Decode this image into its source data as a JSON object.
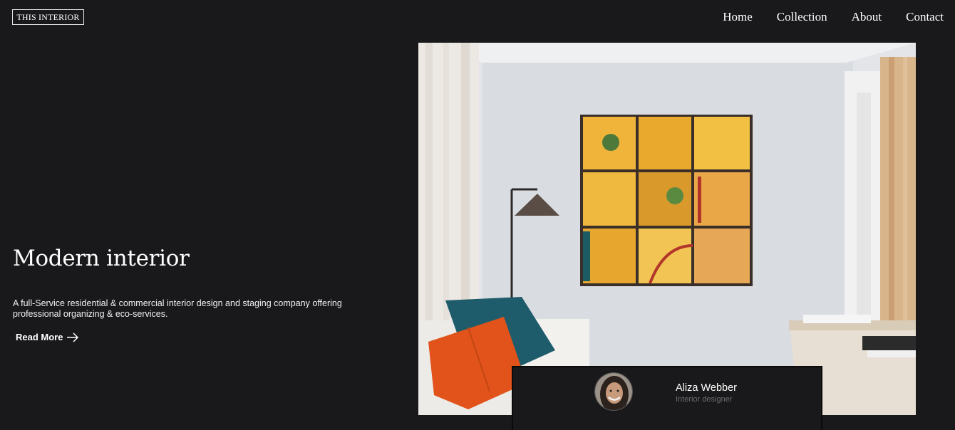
{
  "header": {
    "logo_text": "THIS INTERIOR",
    "nav": [
      {
        "label": "Home"
      },
      {
        "label": "Collection"
      },
      {
        "label": "About"
      },
      {
        "label": "Contact"
      }
    ]
  },
  "hero": {
    "title": "Modern interior",
    "description": "A full-Service residential & commercial interior design and staging company offering professional organizing & eco-services.",
    "cta_label": "Read More",
    "cta_icon": "arrow-right-icon"
  },
  "profile": {
    "name": "Aliza Webber",
    "role": "Interior designer"
  },
  "colors": {
    "background": "#19191b",
    "text": "#ffffff",
    "muted": "#6e6e6e",
    "art_yellow": "#f2b42e",
    "pillow_orange": "#e1531a",
    "pillow_teal": "#1f5c6b"
  }
}
